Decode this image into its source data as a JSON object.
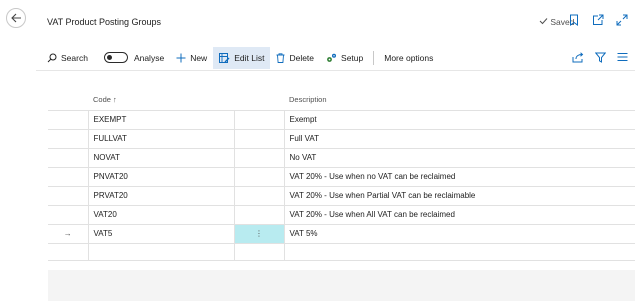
{
  "page": {
    "title": "VAT Product Posting Groups",
    "status": "Saved"
  },
  "actions": {
    "search": "Search",
    "analyse": "Analyse",
    "new": "New",
    "edit_list": "Edit List",
    "delete": "Delete",
    "setup": "Setup",
    "more_options": "More options"
  },
  "table": {
    "columns": {
      "code": "Code ↑",
      "description": "Description"
    },
    "rows": [
      {
        "code": "EXEMPT",
        "description": "Exempt"
      },
      {
        "code": "FULLVAT",
        "description": "Full VAT"
      },
      {
        "code": "NOVAT",
        "description": "No VAT"
      },
      {
        "code": "PNVAT20",
        "description": "VAT 20% - Use when no VAT can be reclaimed"
      },
      {
        "code": "PRVAT20",
        "description": "VAT 20% - Use when Partial VAT can be reclaimable"
      },
      {
        "code": "VAT20",
        "description": "VAT 20% - Use when All VAT can be reclaimed"
      },
      {
        "code": "VAT5",
        "description": "VAT 5%",
        "selector": "→",
        "menu": "⋮"
      }
    ]
  },
  "icons": {
    "back": "back-arrow-icon",
    "bookmark": "bookmark-icon",
    "open_new": "open-new-window-icon",
    "expand": "expand-icon",
    "share": "share-icon",
    "filter": "filter-icon",
    "list": "list-view-icon"
  },
  "colors": {
    "accent": "#0f6cbd",
    "selected_cell": "#b8ebf0",
    "active_action": "#dfe9f5"
  }
}
